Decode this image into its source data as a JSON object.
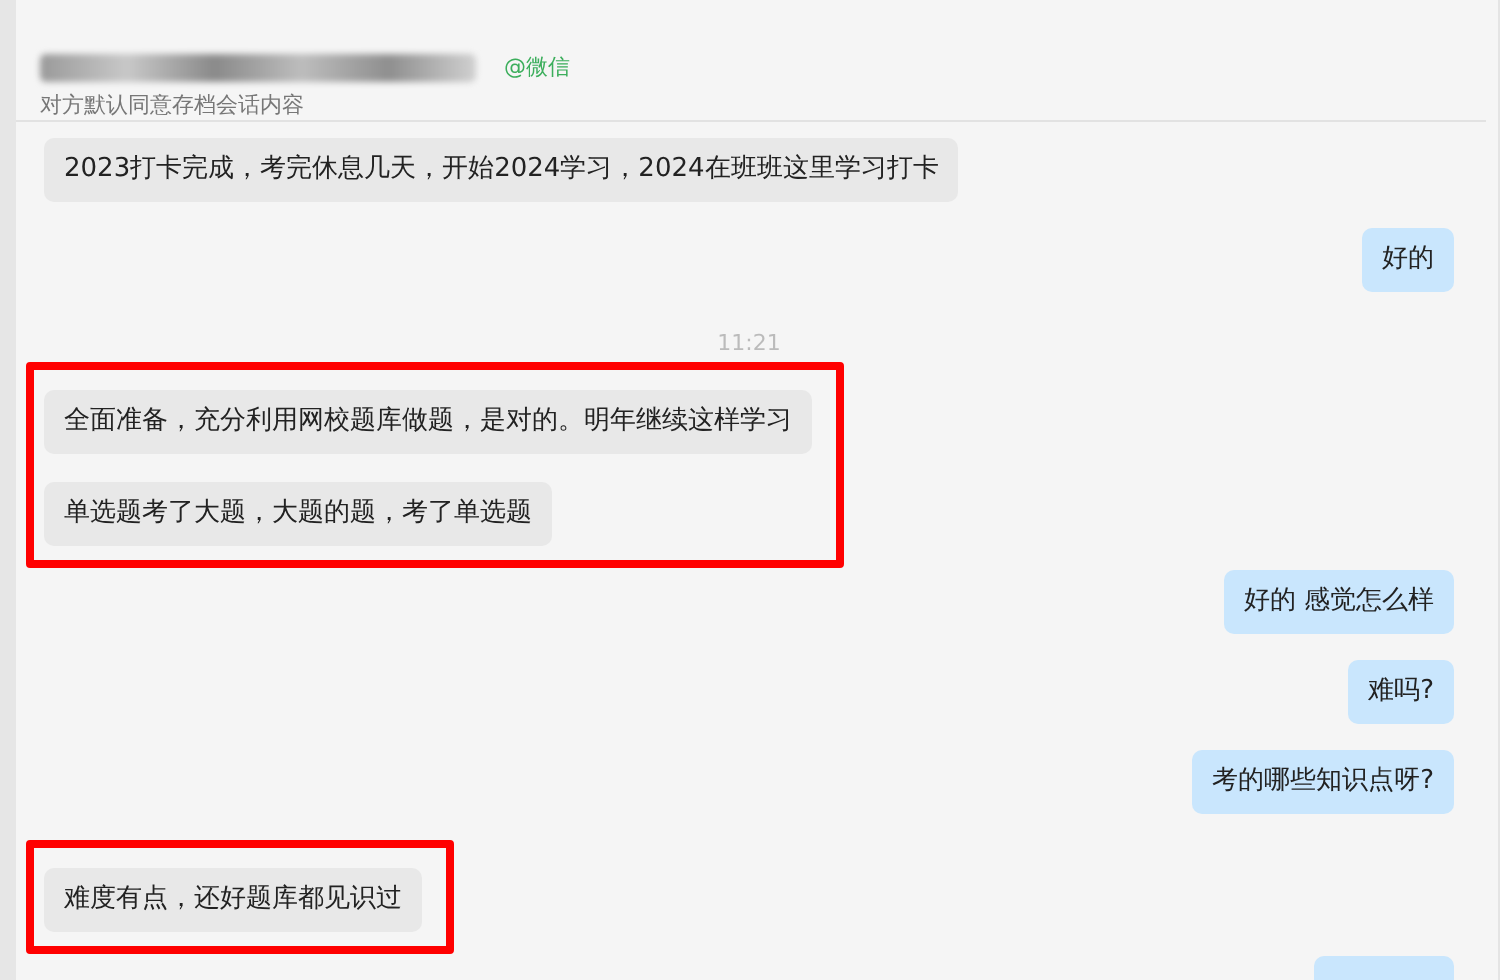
{
  "header": {
    "title_redacted": true,
    "source": "@微信",
    "subtitle": "对方默认同意存档会话内容"
  },
  "items": [
    {
      "kind": "message",
      "outgoing": false,
      "text": "2023打卡完成，考完休息几天，开始2024学习，2024在班班这里学习打卡"
    },
    {
      "kind": "message",
      "outgoing": true,
      "text": "好的"
    },
    {
      "kind": "time",
      "text": "11:21"
    },
    {
      "kind": "highlight",
      "messages": [
        {
          "outgoing": false,
          "text": "全面准备，充分利用网校题库做题，是对的。明年继续这样学习"
        },
        {
          "outgoing": false,
          "text": "单选题考了大题，大题的题，考了单选题"
        }
      ]
    },
    {
      "kind": "message",
      "outgoing": true,
      "text": "好的  感觉怎么样"
    },
    {
      "kind": "message",
      "outgoing": true,
      "text": "难吗?"
    },
    {
      "kind": "message",
      "outgoing": true,
      "text": "考的哪些知识点呀?"
    },
    {
      "kind": "highlight",
      "messages": [
        {
          "outgoing": false,
          "text": "难度有点，还好题库都见识过"
        }
      ]
    },
    {
      "kind": "partial",
      "outgoing": true
    }
  ]
}
